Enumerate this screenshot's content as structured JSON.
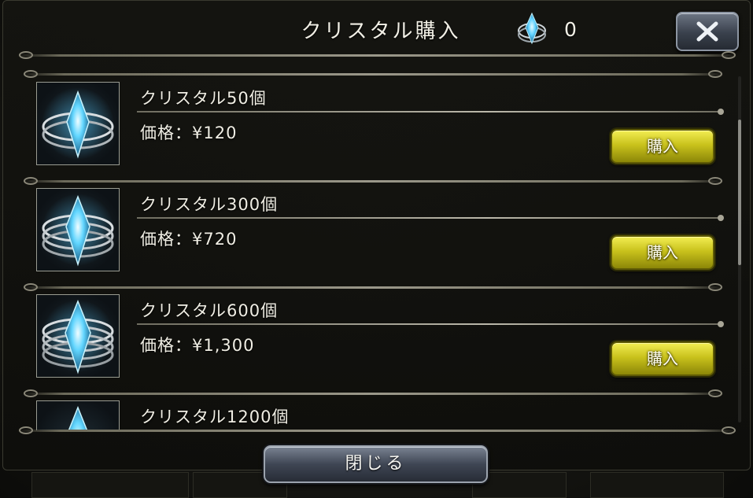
{
  "dialog": {
    "title": "クリスタル購入",
    "crystal_count": "0",
    "close_bottom_label": "閉じる"
  },
  "items": [
    {
      "name": "クリスタル50個",
      "price": "価格：¥120",
      "buy_label": "購入"
    },
    {
      "name": "クリスタル300個",
      "price": "価格：¥720",
      "buy_label": "購入"
    },
    {
      "name": "クリスタル600個",
      "price": "価格：¥1,300",
      "buy_label": "購入"
    },
    {
      "name": "クリスタル1200個"
    }
  ],
  "icons": {
    "close": "close-icon",
    "crystal": "crystal-icon"
  },
  "colors": {
    "buy_button": "#d6cf22",
    "crystal_glow": "#4fc8ff",
    "close_button": "#3f4654"
  }
}
